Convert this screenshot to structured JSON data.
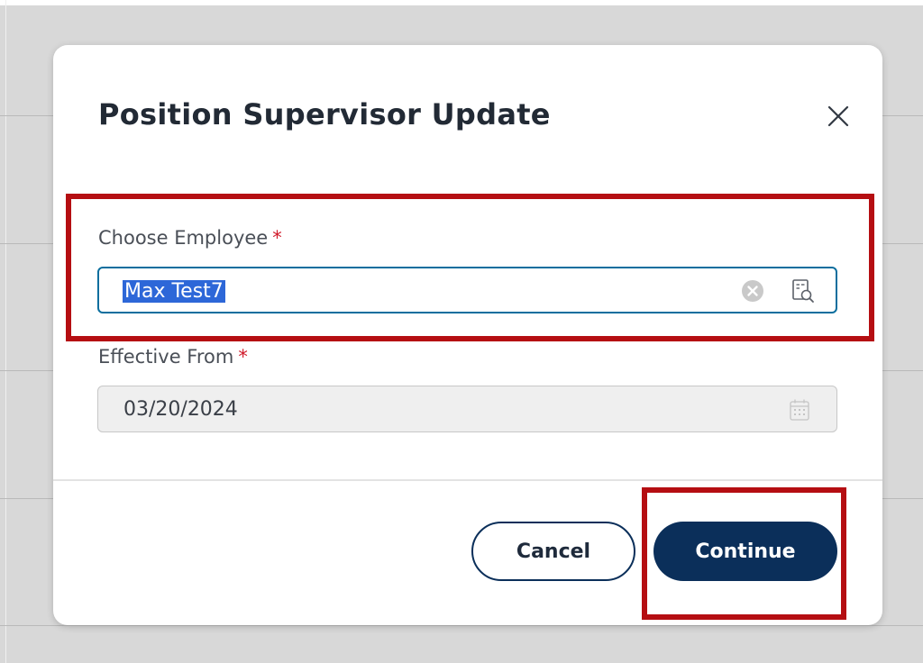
{
  "dialog": {
    "title": "Position Supervisor Update",
    "close_icon": "close-icon"
  },
  "fields": {
    "employee": {
      "label": "Choose Employee",
      "required_mark": "*",
      "value": "Max Test7",
      "value_selected": true,
      "clear_icon": "clear-circle-icon",
      "lookup_icon": "lookup-search-icon"
    },
    "effective_from": {
      "label": "Effective From",
      "required_mark": "*",
      "value": "03/20/2024",
      "disabled": true,
      "calendar_icon": "calendar-icon"
    }
  },
  "actions": {
    "cancel_label": "Cancel",
    "continue_label": "Continue"
  },
  "annotations": {
    "highlight_color": "#b50e12"
  },
  "colors": {
    "primary": "#0b2f5a",
    "focus_border": "#0a6e9e",
    "required": "#d01a2a",
    "selection": "#2d67d8"
  }
}
